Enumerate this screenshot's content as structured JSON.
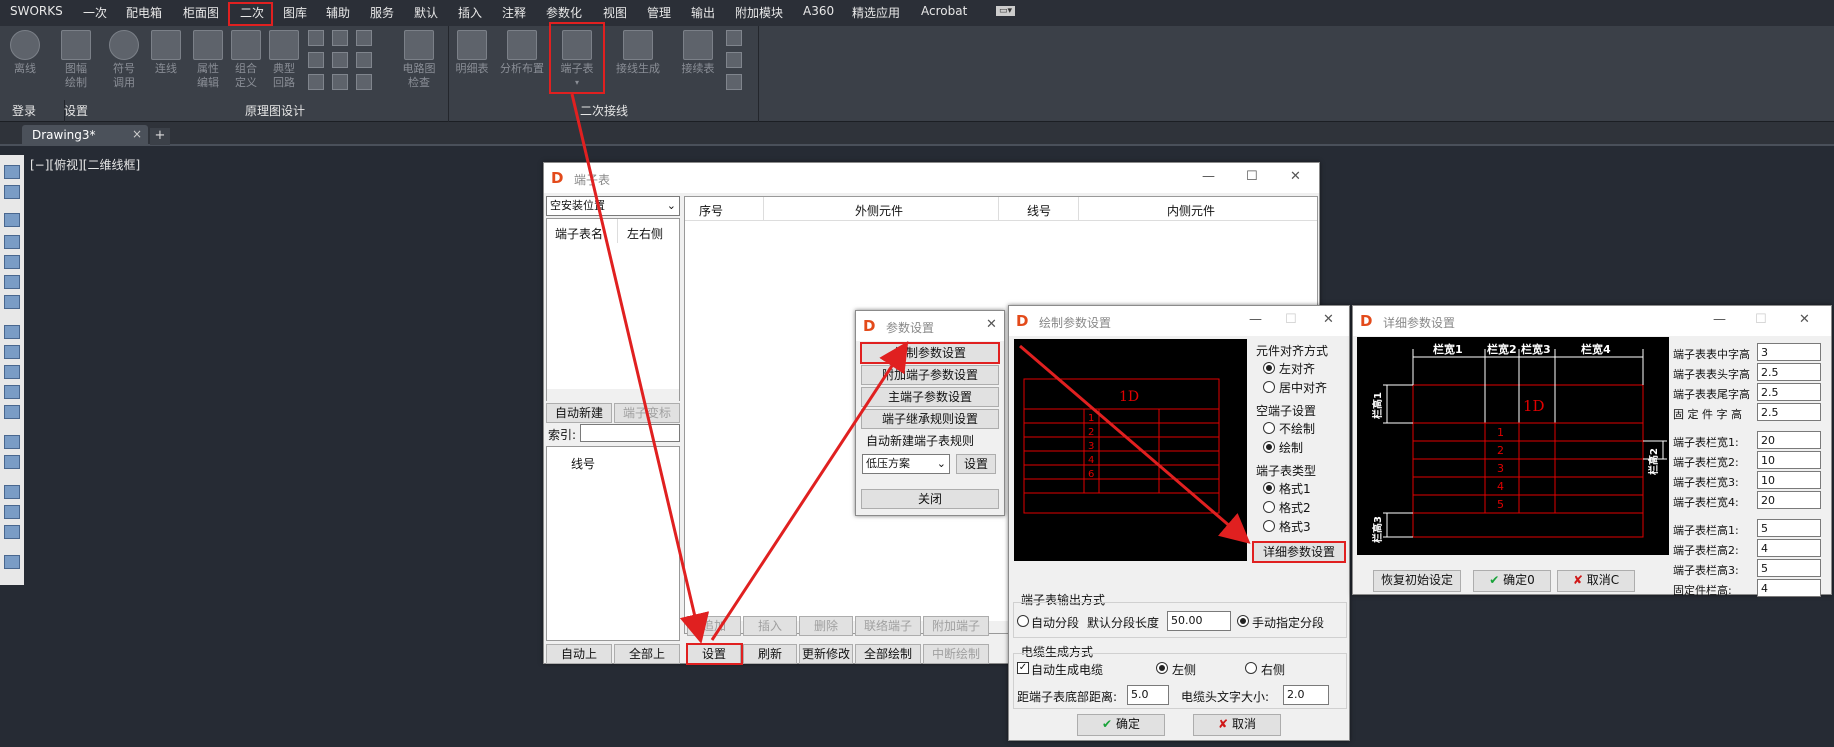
{
  "menubar": [
    "SWORKS",
    "一次",
    "配电箱",
    "柜面图",
    "二次",
    "图库",
    "辅助",
    "服务",
    "默认",
    "插入",
    "注释",
    "参数化",
    "视图",
    "管理",
    "输出",
    "附加模块",
    "A360",
    "精选应用",
    "Acrobat"
  ],
  "ribbon": {
    "buttons": [
      "离线",
      "图幅\n绘制",
      "符号\n调用",
      "连线",
      "属性\n编辑",
      "组合\n定义",
      "典型\n回路",
      "电路图\n检查",
      "明细表",
      "分析布置",
      "端子表",
      "接线生成",
      "接续表"
    ],
    "groups": [
      "登录",
      "设置",
      "原理图设计",
      "二次接线"
    ]
  },
  "tabs": {
    "drawing": "Drawing3*",
    "close": "×",
    "add": "+"
  },
  "viewport_label": "[−][俯视][二维线框]",
  "terminal_win": {
    "title": "端子表",
    "combo": "空安装位置",
    "left_cols": [
      "端子表名",
      "左右侧"
    ],
    "auto_new": "自动新建",
    "terminal_mark": "端子变标",
    "index_label": "索引:",
    "wire_col": "线号",
    "auto_up": "自动上",
    "all_up": "全部上",
    "grid_cols": [
      "序号",
      "外侧元件",
      "线号",
      "内侧元件"
    ],
    "row1": [
      "追加",
      "插入",
      "删除",
      "联络端子",
      "附加端子"
    ],
    "row2": [
      "设置",
      "刷新",
      "更新修改",
      "全部绘制",
      "中断绘制"
    ]
  },
  "param_win": {
    "title": "参数设置",
    "items": [
      "绘制参数设置",
      "附加端子参数设置",
      "主端子参数设置",
      "端子继承规则设置"
    ],
    "rule_label": "自动新建端子表规则",
    "rule_value": "低压方案",
    "set": "设置",
    "close": "关闭"
  },
  "draw_win": {
    "title": "绘制参数设置",
    "preview_title": "1D",
    "preview_rows": [
      "1",
      "2",
      "3",
      "4",
      "6"
    ],
    "align_title": "元件对齐方式",
    "align_opts": [
      "左对齐",
      "居中对齐"
    ],
    "empty_title": "空端子设置",
    "empty_opts": [
      "不绘制",
      "绘制"
    ],
    "type_title": "端子表类型",
    "type_opts": [
      "格式1",
      "格式2",
      "格式3"
    ],
    "detail_btn": "详细参数设置",
    "output_title": "端子表输出方式",
    "auto_seg": "自动分段",
    "seg_len_label": "默认分段长度",
    "seg_len": "50.00",
    "manual_seg": "手动指定分段",
    "cable_title": "电缆生成方式",
    "auto_cable": "自动生成电缆",
    "left": "左侧",
    "right": "右侧",
    "bottom_label": "距端子表底部距离:",
    "bottom_val": "5.0",
    "font_label": "电缆头文字大小:",
    "font_val": "2.0",
    "ok": "确定",
    "cancel": "取消"
  },
  "detail_win": {
    "title": "详细参数设置",
    "preview_title": "1D",
    "col_labels": [
      "栏宽1",
      "栏宽2",
      "栏宽3",
      "栏宽4"
    ],
    "row_labels": [
      "栏高1",
      "栏高2",
      "栏高3"
    ],
    "preview_rows": [
      "1",
      "2",
      "3",
      "4",
      "5"
    ],
    "params": [
      {
        "label": "端子表表中字高",
        "value": "3"
      },
      {
        "label": "端子表表头字高",
        "value": "2.5"
      },
      {
        "label": "端子表表尾字高",
        "value": "2.5"
      },
      {
        "label": "固 定 件 字 高",
        "value": "2.5"
      },
      {
        "label": "端子表栏宽1:",
        "value": "20"
      },
      {
        "label": "端子表栏宽2:",
        "value": "10"
      },
      {
        "label": "端子表栏宽3:",
        "value": "10"
      },
      {
        "label": "端子表栏宽4:",
        "value": "20"
      },
      {
        "label": "端子表栏高1:",
        "value": "5"
      },
      {
        "label": "端子表栏高2:",
        "value": "4"
      },
      {
        "label": "端子表栏高3:",
        "value": "5"
      },
      {
        "label": "固定件栏高:",
        "value": "4"
      }
    ],
    "restore": "恢复初始设定",
    "ok": "确定0",
    "cancel": "取消C"
  },
  "colors": {
    "annotation": "#e02020",
    "preview_bg": "#000000",
    "preview_line": "#e00000"
  }
}
